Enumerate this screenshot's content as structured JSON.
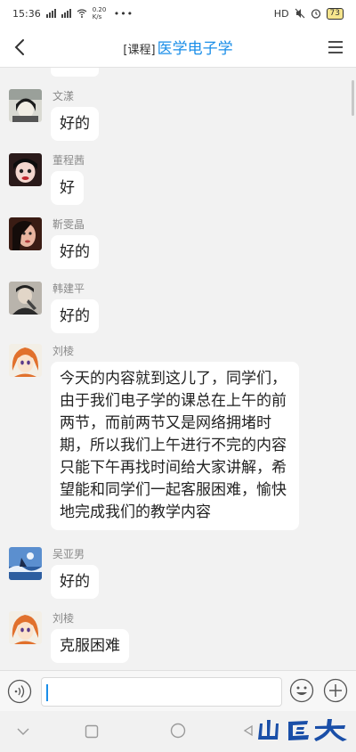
{
  "status_bar": {
    "time": "15:36",
    "network_speed": "0.20 K/s",
    "hd_label": "HD",
    "battery": "73"
  },
  "header": {
    "tag": "[课程]",
    "title": "医学电子学"
  },
  "messages": [
    {
      "sender": "文漾",
      "text": "好的"
    },
    {
      "sender": "董程茜",
      "text": "好"
    },
    {
      "sender": "靳雯晶",
      "text": "好的"
    },
    {
      "sender": "韩建平",
      "text": "好的"
    },
    {
      "sender": "刘棱",
      "text": "今天的内容就到这儿了，同学们，由于我们电子学的课总在上午的前两节，而前两节又是网络拥堵时期，所以我们上午进行不完的内容只能下午再找时间给大家讲解，希望能和同学们一起客服困难，愉快地完成我们的教学内容"
    },
    {
      "sender": "吴亚男",
      "text": "好的"
    },
    {
      "sender": "刘棱",
      "text": "克服困难"
    }
  ],
  "input": {
    "value": "",
    "placeholder": ""
  },
  "icons": {
    "back": "chevron-left-icon",
    "menu": "hamburger-menu-icon",
    "voice": "voice-input-icon",
    "emoji": "emoji-icon",
    "plus": "plus-icon"
  },
  "colors": {
    "title_blue": "#1a8ee8",
    "bubble_white": "#ffffff",
    "chat_bg": "#f2f2f2",
    "watermark_blue": "#1a4fa8"
  }
}
